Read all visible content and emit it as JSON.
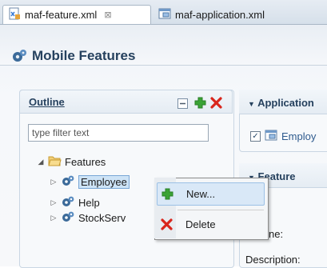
{
  "tabs": [
    {
      "label": "maf-feature.xml",
      "close": "⊠",
      "active": true
    },
    {
      "label": "maf-application.xml",
      "active": false
    }
  ],
  "page_title": "Mobile Features",
  "outline": {
    "title": "Outline",
    "filter_placeholder": "type filter text",
    "tree": {
      "root": "Features",
      "children": [
        "Employee",
        "Help",
        "StockServ"
      ]
    }
  },
  "application_section": {
    "title": "Application",
    "item_label": "Employ"
  },
  "feature_section": {
    "title": "Feature",
    "field_name_partial": "ne:",
    "description_label": "Description:"
  },
  "context_menu": {
    "items": [
      {
        "label": "New..."
      },
      {
        "label": "Delete"
      }
    ]
  },
  "colors": {
    "accent_title": "#26415e",
    "add_green": "#3aa335",
    "delete_red": "#d9261c",
    "folder": "#e8b44a",
    "selection": "#cde3f6"
  }
}
